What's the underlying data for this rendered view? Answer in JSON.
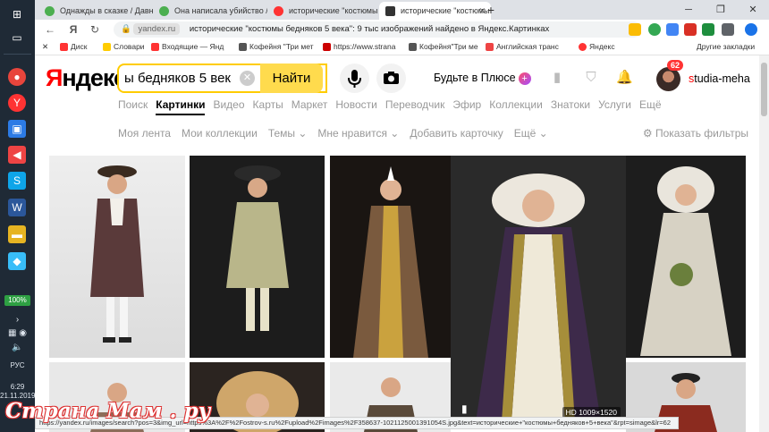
{
  "taskbar": {
    "battery": "100%",
    "lang": "РУС",
    "time": "6:29",
    "date": "21.11.2019"
  },
  "tabs": [
    {
      "title": "Однажды в сказке / Давн",
      "active": false
    },
    {
      "title": "Она написала убийство / з",
      "active": false
    },
    {
      "title": "исторические \"костюмы б",
      "active": false
    },
    {
      "title": "исторические \"костюмы б",
      "active": true
    }
  ],
  "address": {
    "host": "yandex.ru",
    "title": "исторические \"костюмы бедняков 5 века\": 9 тыс изображений найдено в Яндекс.Картинках"
  },
  "bookmarks": {
    "items": [
      "Диск",
      "Словари",
      "Входящие — Янд",
      "Кофейня \"Три мет",
      "https://www.strana",
      "Кофейня\"Три ме",
      "Английская транс",
      "Яндекс"
    ],
    "other": "Другие закладки"
  },
  "header": {
    "logo": "Яндекс",
    "query": "ы бедняков 5 века\"",
    "find": "Найти",
    "plus": "Будьте в Плюсе",
    "notifications": "62",
    "user_first": "s",
    "user_rest": "tudia-meha"
  },
  "services": [
    "Поиск",
    "Картинки",
    "Видео",
    "Карты",
    "Маркет",
    "Новости",
    "Переводчик",
    "Эфир",
    "Коллекции",
    "Знатоки",
    "Услуги",
    "Ещё"
  ],
  "filters": [
    "Моя лента",
    "Мои коллекции",
    "Темы ⌄",
    "Мне нравится ⌄",
    "Добавить карточку",
    "Ещё ⌄"
  ],
  "show_filters": "Показать фильтры",
  "hovered_image": {
    "quality": "HD",
    "size": "1009×1520"
  },
  "status_url": "https://yandex.ru/images/search?pos=3&img_url=https%3A%2F%2Fostrov-s.ru%2Fupload%2Fimages%2F358637-1021125001391054S.jpg&text=исторические+\"костюмы+бедняков+5+века\"&rpt=simage&lr=62",
  "watermark": "Страна Мам . ру"
}
